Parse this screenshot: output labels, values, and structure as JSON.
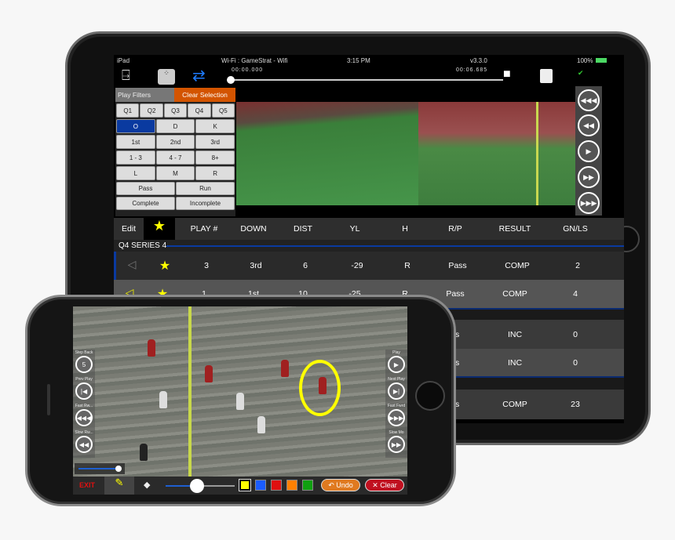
{
  "status_bar": {
    "device": "iPad",
    "network": "Wi-Fi : GameStrat - Wifi",
    "time": "3:15 PM",
    "version": "v3.3.0",
    "battery": "100%"
  },
  "toolbar": {
    "time_start": "00:00.000",
    "time_end": "00:06.685",
    "icons": [
      "exit-door-icon",
      "playbook-icon",
      "loop-icon",
      "camera-stream-icon",
      "stats-icon",
      "connection-icon"
    ]
  },
  "filters": {
    "title": "Play Filters",
    "clear": "Clear Selection",
    "rows": [
      [
        "Q1",
        "Q2",
        "Q3",
        "Q4",
        "Q5"
      ],
      [
        "O",
        "D",
        "K"
      ],
      [
        "1st",
        "2nd",
        "3rd"
      ],
      [
        "1 - 3",
        "4 - 7",
        "8+"
      ],
      [
        "L",
        "M",
        "R"
      ],
      [
        "Pass",
        "Run"
      ],
      [
        "Complete",
        "Incomplete"
      ]
    ],
    "selected": "O"
  },
  "table": {
    "edit": "Edit",
    "columns": [
      "PLAY #",
      "DOWN",
      "DIST",
      "YL",
      "H",
      "R/P",
      "RESULT",
      "GN/LS"
    ],
    "series": "Q4 SERIES 4",
    "rows": [
      {
        "play": "3",
        "down": "3rd",
        "dist": "6",
        "yl": "-29",
        "h": "R",
        "rp": "Pass",
        "result": "COMP",
        "gnls": "2"
      },
      {
        "play": "1",
        "down": "1st",
        "dist": "10",
        "yl": "-25",
        "h": "R",
        "rp": "Pass",
        "result": "COMP",
        "gnls": "4"
      },
      {
        "rp": "ss",
        "result": "INC",
        "gnls": "0"
      },
      {
        "rp": "ss",
        "result": "INC",
        "gnls": "0"
      },
      {
        "rp": "ss",
        "result": "COMP",
        "gnls": "23"
      }
    ]
  },
  "phone": {
    "left_controls": [
      "Step Back",
      "Prev Play",
      "Fast Rw...",
      "Slow Rw..."
    ],
    "right_controls": [
      "Play",
      "Next Play",
      "Fast Fwrd",
      "Slow Mo"
    ],
    "step_value": "5",
    "exit": "EXIT",
    "undo": "Undo",
    "clear": "Clear",
    "colors": [
      "#ffff00",
      "#1a5cff",
      "#e01010",
      "#ff8000",
      "#10a010"
    ],
    "selected_color": "#ffff00",
    "pen_size": 0.5,
    "scrub": 0.95
  },
  "accent": "#d35400"
}
